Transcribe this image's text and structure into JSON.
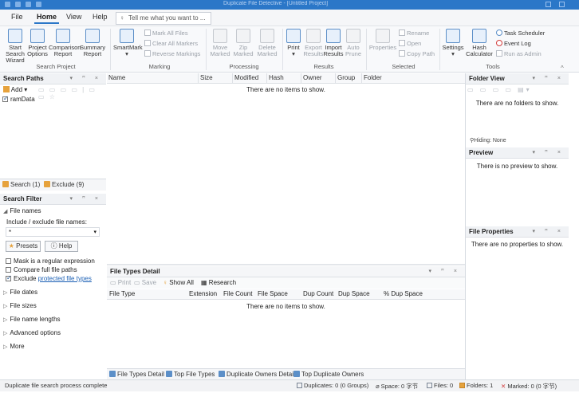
{
  "titlebar": {
    "title": "Duplicate File Detective - [Untitled Project]"
  },
  "menu": {
    "file": "File",
    "home": "Home",
    "view": "View",
    "help": "Help",
    "tell_me": "Tell me what you want to ..."
  },
  "ribbon": {
    "search_project": {
      "start": [
        "Start",
        "Search Wizard"
      ],
      "project": [
        "Project",
        "Options"
      ],
      "comparison": [
        "Comparison",
        "Report"
      ],
      "summary": [
        "Summary",
        "Report"
      ],
      "label": "Search Project"
    },
    "marking": {
      "smartmark": "SmartMark",
      "mark_all": "Mark All Files",
      "clear_all": "Clear All Markers",
      "reverse": "Reverse Markings",
      "label": "Marking"
    },
    "processing": {
      "move": [
        "Move",
        "Marked"
      ],
      "zip": [
        "Zip",
        "Marked"
      ],
      "delete": [
        "Delete",
        "Marked"
      ],
      "label": "Processing"
    },
    "results": {
      "print": "Print",
      "export": [
        "Export",
        "Results"
      ],
      "import": [
        "Import",
        "Results"
      ],
      "auto": [
        "Auto",
        "Prune"
      ],
      "label": "Results"
    },
    "selected": {
      "properties": "Properties",
      "rename": "Rename",
      "open": "Open",
      "copy_path": "Copy Path",
      "label": "Selected"
    },
    "tools": {
      "settings": "Settings",
      "hash": [
        "Hash",
        "Calculator"
      ],
      "task_scheduler": "Task Scheduler",
      "event_log": "Event Log",
      "run_as_admin": "Run as Admin",
      "label": "Tools"
    }
  },
  "search_paths": {
    "title": "Search Paths",
    "add": "Add",
    "items": [
      "ramData"
    ],
    "tab_search": "Search (1)",
    "tab_exclude": "Exclude (9)"
  },
  "search_filter": {
    "title": "Search Filter",
    "file_names": "File names",
    "include_label": "Include / exclude file names:",
    "pattern_value": "*",
    "presets": "Presets",
    "help": "Help",
    "mask_regex": "Mask is a regular expression",
    "compare_full": "Compare full file paths",
    "exclude_prefix": "Exclude",
    "exclude_link": "protected file types",
    "sections": [
      "File dates",
      "File sizes",
      "File name lengths",
      "Advanced options",
      "More"
    ]
  },
  "results_grid": {
    "columns": [
      "Name",
      "Size",
      "Modified",
      "Hash",
      "Owner",
      "Group",
      "Folder"
    ],
    "empty": "There are no items to show."
  },
  "file_types": {
    "title": "File Types Detail",
    "print": "Print",
    "save": "Save",
    "show_all": "Show All",
    "research": "Research",
    "columns": [
      "File Type",
      "Extension",
      "File Count",
      "File Space",
      "Dup Count",
      "Dup Space",
      "% Dup Space"
    ],
    "empty": "There are no items to show.",
    "tabs": [
      "File Types Detail",
      "Top File Types",
      "Duplicate Owners Detail",
      "Top Duplicate Owners"
    ]
  },
  "folder_view": {
    "title": "Folder View",
    "empty": "There are no folders to show.",
    "hiding": "Hiding: None"
  },
  "preview": {
    "title": "Preview",
    "empty": "There is no preview to show."
  },
  "file_properties": {
    "title": "File Properties",
    "empty": "There are no properties to show."
  },
  "status": {
    "message": "Duplicate file search process complete",
    "duplicates": "Duplicates: 0 (0 Groups)",
    "space": "Space: 0 字节",
    "files": "Files: 0",
    "folders": "Folders: 1",
    "marked": "Marked: 0 (0 字节)"
  },
  "colors": {
    "accent": "#2b77c8",
    "marked_x": "#d23c3c",
    "folder": "#e6a23c"
  }
}
